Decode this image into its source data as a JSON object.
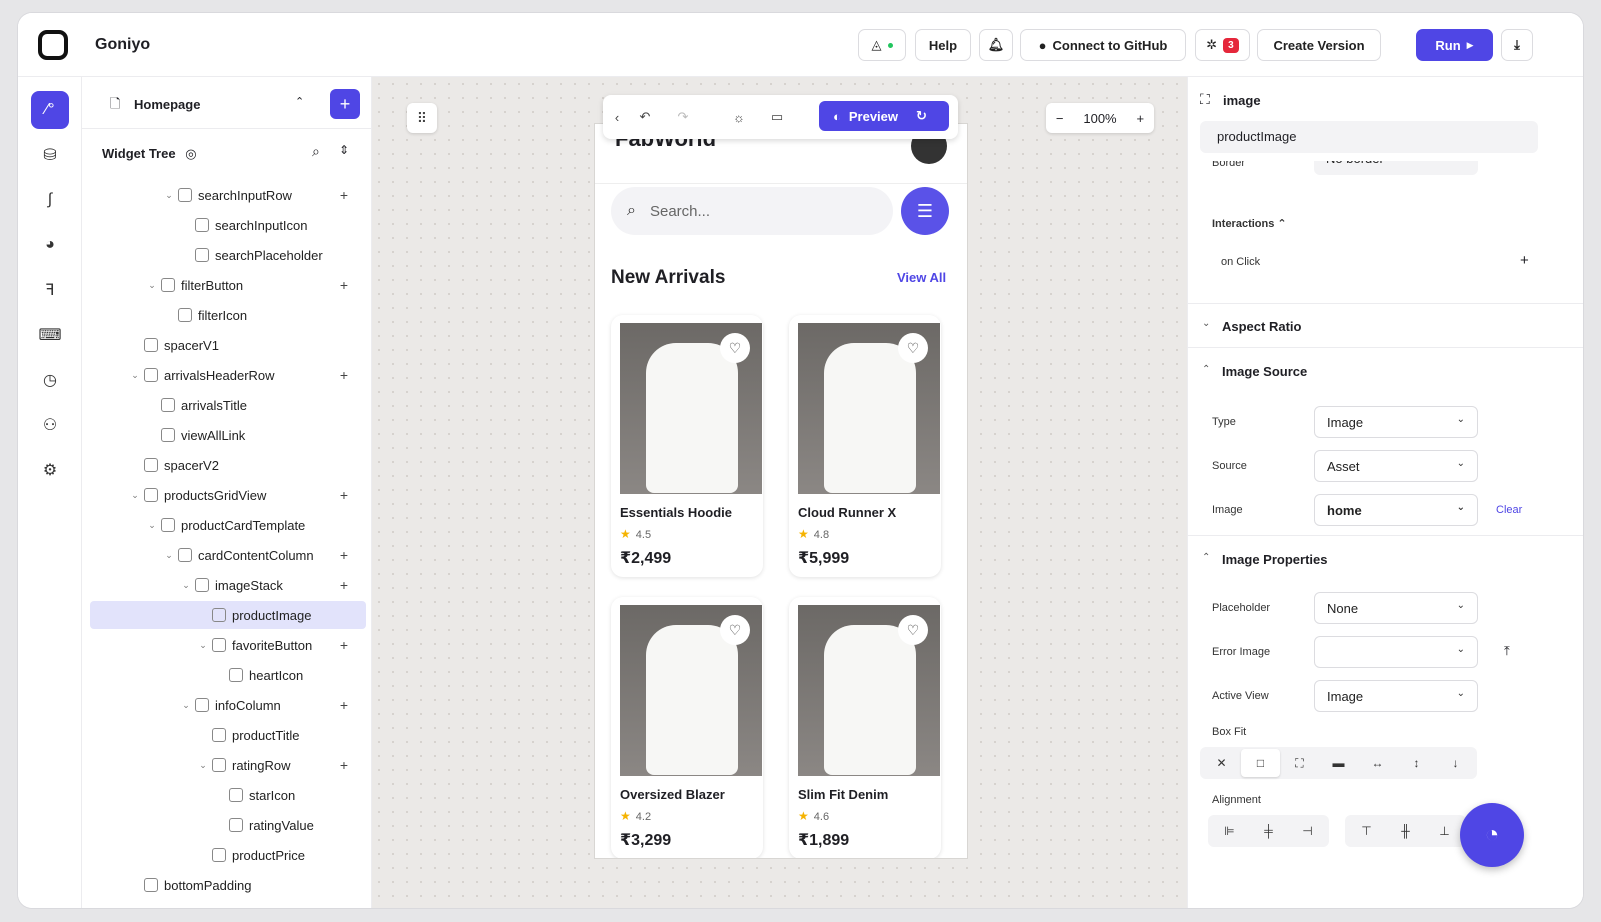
{
  "header": {
    "app_title": "Goniyo",
    "help": "Help",
    "github": "Connect to GitHub",
    "bug_count": "3",
    "create_version": "Create Version",
    "run": "Run"
  },
  "tree": {
    "page": "Homepage",
    "widget_tree_label": "Widget Tree",
    "items": [
      {
        "label": "searchInputRow",
        "indent": 3,
        "chev": "v",
        "plus": true
      },
      {
        "label": "searchInputIcon",
        "indent": 4,
        "chev": "",
        "plus": false
      },
      {
        "label": "searchPlaceholder",
        "indent": 4,
        "chev": "",
        "plus": false
      },
      {
        "label": "filterButton",
        "indent": 2,
        "chev": "v",
        "plus": true
      },
      {
        "label": "filterIcon",
        "indent": 3,
        "chev": "",
        "plus": false
      },
      {
        "label": "spacerV1",
        "indent": 1,
        "chev": "",
        "plus": false
      },
      {
        "label": "arrivalsHeaderRow",
        "indent": 1,
        "chev": "v",
        "plus": true
      },
      {
        "label": "arrivalsTitle",
        "indent": 2,
        "chev": "",
        "plus": false
      },
      {
        "label": "viewAllLink",
        "indent": 2,
        "chev": "",
        "plus": false
      },
      {
        "label": "spacerV2",
        "indent": 1,
        "chev": "",
        "plus": false
      },
      {
        "label": "productsGridView",
        "indent": 1,
        "chev": "v",
        "plus": true
      },
      {
        "label": "productCardTemplate",
        "indent": 2,
        "chev": "v",
        "plus": false
      },
      {
        "label": "cardContentColumn",
        "indent": 3,
        "chev": "v",
        "plus": true
      },
      {
        "label": "imageStack",
        "indent": 4,
        "chev": "v",
        "plus": true
      },
      {
        "label": "productImage",
        "indent": 5,
        "chev": "",
        "plus": false,
        "selected": true
      },
      {
        "label": "favoriteButton",
        "indent": 5,
        "chev": "v",
        "plus": true
      },
      {
        "label": "heartIcon",
        "indent": 6,
        "chev": "",
        "plus": false
      },
      {
        "label": "infoColumn",
        "indent": 4,
        "chev": "v",
        "plus": true
      },
      {
        "label": "productTitle",
        "indent": 5,
        "chev": "",
        "plus": false
      },
      {
        "label": "ratingRow",
        "indent": 5,
        "chev": "v",
        "plus": true
      },
      {
        "label": "starIcon",
        "indent": 6,
        "chev": "",
        "plus": false
      },
      {
        "label": "ratingValue",
        "indent": 6,
        "chev": "",
        "plus": false
      },
      {
        "label": "productPrice",
        "indent": 5,
        "chev": "",
        "plus": false
      },
      {
        "label": "bottomPadding",
        "indent": 1,
        "chev": "",
        "plus": false
      }
    ]
  },
  "canvas": {
    "zoom": "100%",
    "preview": "Preview",
    "app_brand": "FabWorld",
    "search_placeholder": "Search...",
    "section_title": "New Arrivals",
    "view_all": "View All",
    "products": [
      {
        "title": "Essentials Hoodie",
        "rating": "4.5",
        "price": "₹2,499"
      },
      {
        "title": "Cloud Runner X",
        "rating": "4.8",
        "price": "₹5,999"
      },
      {
        "title": "Oversized Blazer",
        "rating": "4.2",
        "price": "₹3,299"
      },
      {
        "title": "Slim Fit Denim",
        "rating": "4.6",
        "price": "₹1,899"
      }
    ]
  },
  "props": {
    "widget_type": "image",
    "widget_name": "productImage",
    "border_label": "Border",
    "border_value": "No border",
    "interactions": "Interactions",
    "on_click": "on Click",
    "aspect_ratio": "Aspect Ratio",
    "image_source": "Image Source",
    "type_label": "Type",
    "type_value": "Image",
    "source_label": "Source",
    "source_value": "Asset",
    "image_label": "Image",
    "image_value": "home",
    "clear": "Clear",
    "image_properties": "Image Properties",
    "placeholder_label": "Placeholder",
    "placeholder_value": "None",
    "error_image_label": "Error Image",
    "active_view_label": "Active View",
    "active_view_value": "Image",
    "box_fit": "Box Fit",
    "alignment": "Alignment"
  },
  "colors": {
    "accent": "#4f46e5",
    "badge": "#e5273b",
    "star": "#f5b301"
  }
}
